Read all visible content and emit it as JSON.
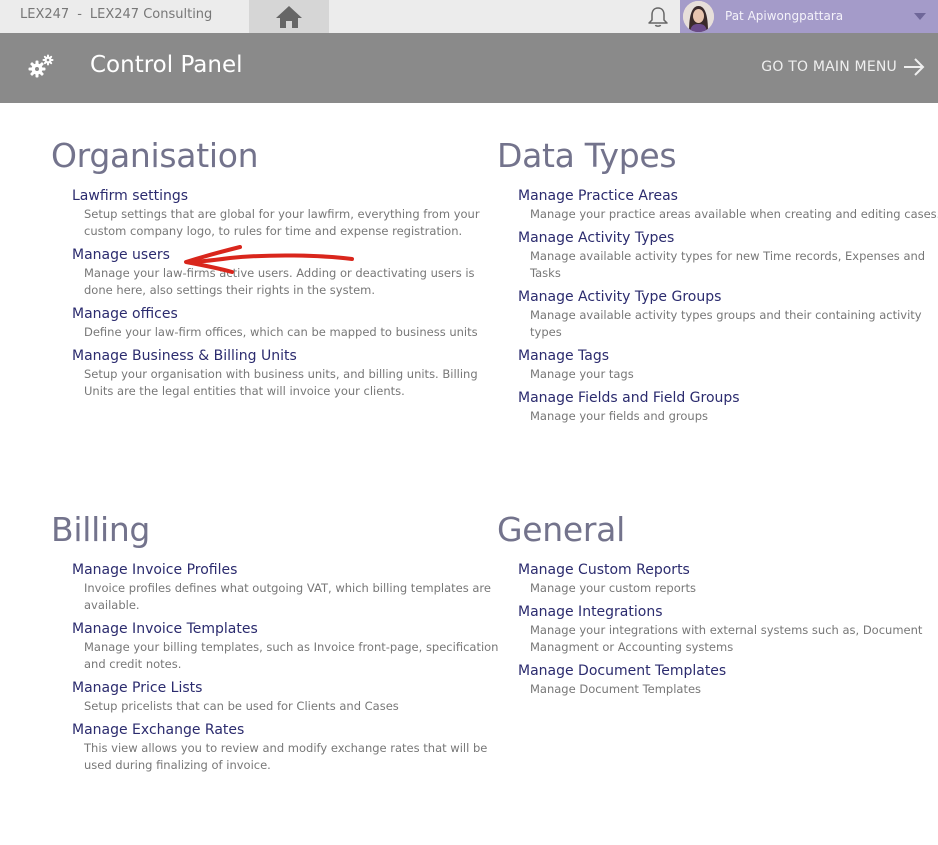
{
  "topbar": {
    "app_code": "LEX247",
    "separator": "-",
    "company": "LEX247 Consulting",
    "home_icon": "home-icon",
    "bell_icon": "bell-icon",
    "user_name": "Pat Apiwongpattara",
    "user_area_color": "#a49bc9"
  },
  "header": {
    "icon": "gears-icon",
    "title": "Control Panel",
    "main_menu_label": "GO TO MAIN MENU",
    "main_menu_icon": "arrow-right-icon",
    "background_color": "#8a8a8a"
  },
  "sections": {
    "organisation": {
      "title": "Organisation",
      "items": [
        {
          "label": "Lawfirm settings",
          "description": "Setup settings that are global for your lawfirm, everything from your custom company logo, to rules for time and expense registration."
        },
        {
          "label": "Manage users",
          "description": "Manage your law-firms active users. Adding or deactivating users is done here, also settings their rights in the system."
        },
        {
          "label": "Manage offices",
          "description": "Define your law-firm offices, which can be mapped to business units"
        },
        {
          "label": "Manage Business & Billing Units",
          "description": "Setup your organisation with business units, and billing units. Billing Units are the legal entities that will invoice your clients."
        }
      ]
    },
    "data_types": {
      "title": "Data Types",
      "items": [
        {
          "label": "Manage Practice Areas",
          "description": "Manage your practice areas available when creating and editing cases."
        },
        {
          "label": "Manage Activity Types",
          "description": "Manage available activity types for new Time records, Expenses and Tasks"
        },
        {
          "label": "Manage Activity Type Groups",
          "description": "Manage available activity types groups and their containing activity types"
        },
        {
          "label": "Manage Tags",
          "description": "Manage your tags"
        },
        {
          "label": "Manage Fields and Field Groups",
          "description": "Manage your fields and groups"
        }
      ]
    },
    "billing": {
      "title": "Billing",
      "items": [
        {
          "label": "Manage Invoice Profiles",
          "description": "Invoice profiles defines what outgoing VAT, which billing templates are available."
        },
        {
          "label": "Manage Invoice Templates",
          "description": "Manage your billing templates, such as Invoice front-page, specification and credit notes."
        },
        {
          "label": "Manage Price Lists",
          "description": "Setup pricelists that can be used for Clients and Cases"
        },
        {
          "label": "Manage Exchange Rates",
          "description": "This view allows you to review and modify exchange rates that will be used during finalizing of invoice."
        }
      ]
    },
    "general": {
      "title": "General",
      "items": [
        {
          "label": "Manage Custom Reports",
          "description": "Manage your custom reports"
        },
        {
          "label": "Manage Integrations",
          "description": "Manage your integrations with external systems such as, Document Managment or Accounting systems"
        },
        {
          "label": "Manage Document Templates",
          "description": "Manage Document Templates"
        }
      ]
    }
  },
  "annotation": {
    "icon": "red-arrow-annotation",
    "color": "#d9261c"
  }
}
